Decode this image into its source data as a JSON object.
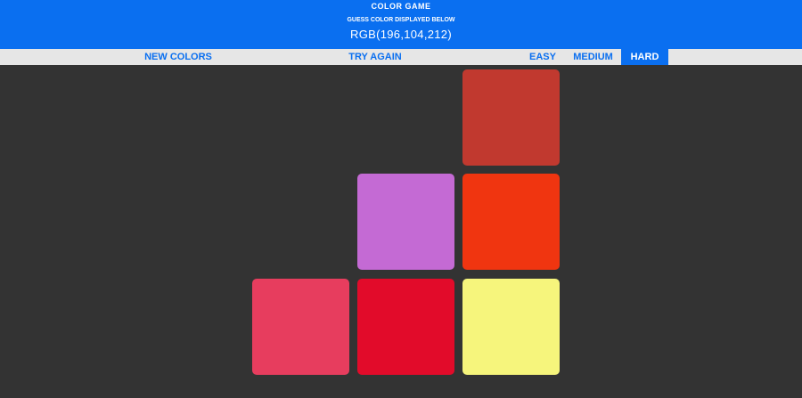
{
  "header": {
    "title": "COLOR GAME",
    "subtitle": "GUESS COLOR DISPLAYED BELOW",
    "target_rgb": "RGB(196,104,212)",
    "background_color": "#0a6ff0"
  },
  "nav": {
    "new_colors": "NEW COLORS",
    "message": "TRY AGAIN",
    "modes": [
      {
        "label": "EASY",
        "selected": false
      },
      {
        "label": "MEDIUM",
        "selected": false
      },
      {
        "label": "HARD",
        "selected": true
      }
    ]
  },
  "squares": [
    {
      "color": "#c1392f",
      "visible": true
    },
    {
      "color": "#c46ad4",
      "visible": true
    },
    {
      "color": "#f03510",
      "visible": true
    },
    {
      "color": "#e73d5e",
      "visible": true
    },
    {
      "color": "#e20b2a",
      "visible": true
    },
    {
      "color": "#f6f57c",
      "visible": true
    }
  ],
  "colors": {
    "page_background": "#333333",
    "nav_background": "#e6e6e6",
    "accent": "#0a6ff0"
  }
}
